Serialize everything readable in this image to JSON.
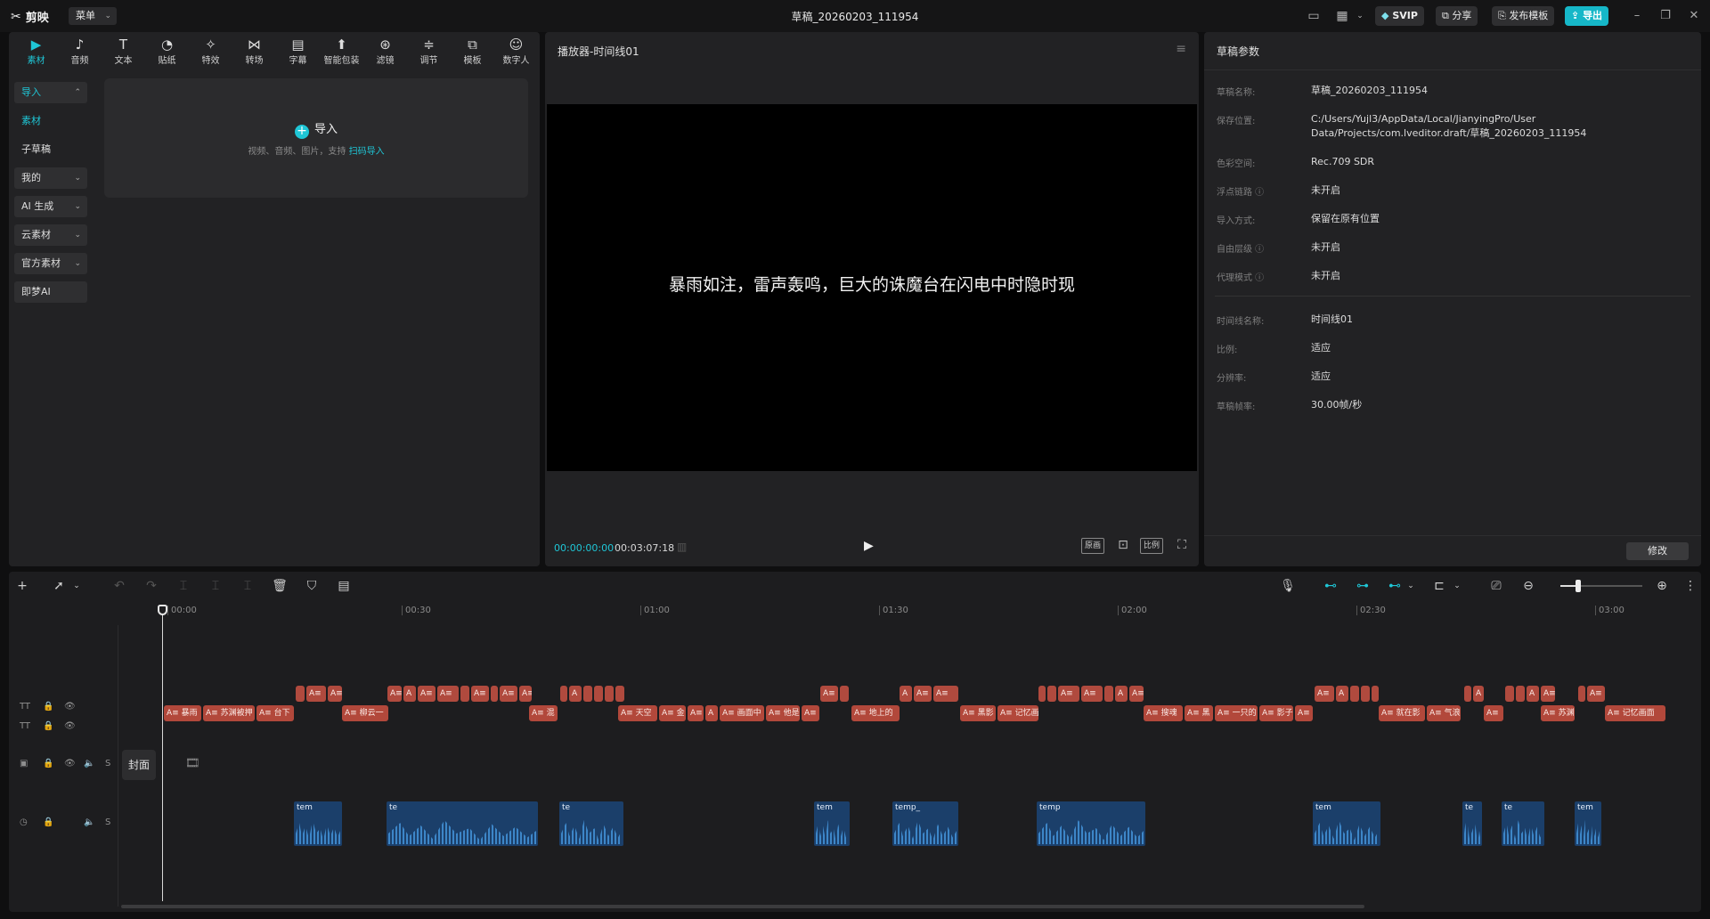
{
  "titlebar": {
    "app_name": "剪映",
    "menu_label": "菜单",
    "doc_title": "草稿_20260203_111954",
    "svip": "SVIP",
    "share": "分享",
    "publish_template": "发布模板",
    "export": "导出"
  },
  "categories": [
    {
      "label": "素材",
      "icon": "media-icon",
      "glyph": "▶"
    },
    {
      "label": "音频",
      "icon": "audio-icon",
      "glyph": "♪"
    },
    {
      "label": "文本",
      "icon": "text-icon",
      "glyph": "T"
    },
    {
      "label": "贴纸",
      "icon": "sticker-icon",
      "glyph": "◔"
    },
    {
      "label": "特效",
      "icon": "effects-icon",
      "glyph": "✧"
    },
    {
      "label": "转场",
      "icon": "transition-icon",
      "glyph": "⋈"
    },
    {
      "label": "字幕",
      "icon": "caption-icon",
      "glyph": "▤"
    },
    {
      "label": "智能包装",
      "icon": "smart-pack-icon",
      "glyph": "⬆"
    },
    {
      "label": "滤镜",
      "icon": "filter-icon",
      "glyph": "⊛"
    },
    {
      "label": "调节",
      "icon": "adjust-icon",
      "glyph": "≑"
    },
    {
      "label": "模板",
      "icon": "template-icon",
      "glyph": "⧉"
    },
    {
      "label": "数字人",
      "icon": "avatar-icon",
      "glyph": "☺"
    }
  ],
  "sidebar": {
    "items": [
      {
        "label": "导入",
        "chev": "⌃"
      },
      {
        "label": "素材",
        "chev": ""
      },
      {
        "label": "子草稿",
        "chev": ""
      },
      {
        "label": "我的",
        "chev": "⌄"
      },
      {
        "label": "AI 生成",
        "chev": "⌄"
      },
      {
        "label": "云素材",
        "chev": "⌄"
      },
      {
        "label": "官方素材",
        "chev": "⌄"
      },
      {
        "label": "即梦AI",
        "chev": ""
      }
    ]
  },
  "import_card": {
    "title": "导入",
    "subtitle": "视频、音频、图片，支持",
    "link": "扫码导入"
  },
  "player": {
    "title": "播放器-时间线01",
    "subtitle_text": "暴雨如注，雷声轰鸣，巨大的诛魔台在闪电中时隐时现",
    "current_time": "00:00:00:00",
    "total_time": "00:03:07:18",
    "ctl_quality": "原画",
    "ctl_ratio": "比例"
  },
  "params": {
    "title": "草稿参数",
    "rows": [
      {
        "label": "草稿名称:",
        "value": "草稿_20260203_111954"
      },
      {
        "label": "保存位置:",
        "value": "C:/Users/Yujl3/AppData/Local/JianyingPro/User Data/Projects/com.lveditor.draft/草稿_20260203_111954"
      },
      {
        "label": "色彩空间:",
        "value": "Rec.709 SDR"
      },
      {
        "label": "浮点链路 ⓘ",
        "value": "未开启"
      },
      {
        "label": "导入方式:",
        "value": "保留在原有位置"
      },
      {
        "label": "自由层级 ⓘ",
        "value": "未开启"
      },
      {
        "label": "代理模式 ⓘ",
        "value": "未开启"
      }
    ],
    "rows2": [
      {
        "label": "时间线名称:",
        "value": "时间线01"
      },
      {
        "label": "比例:",
        "value": "适应"
      },
      {
        "label": "分辨率:",
        "value": "适应"
      },
      {
        "label": "草稿帧率:",
        "value": "30.00帧/秒"
      }
    ],
    "modify": "修改"
  },
  "timeline": {
    "ruler": [
      "00:00",
      "00:30",
      "01:00",
      "01:30",
      "02:00",
      "02:30",
      "03:00"
    ],
    "cover_label": "封面",
    "track_headers": {
      "solo": "S"
    },
    "text_track_2_labels": [
      "暴雨",
      "苏渊被押",
      "台下",
      "柳云一",
      "混",
      "天空",
      "金",
      "画面中",
      "他是",
      "地上的",
      "黑影",
      "记忆画",
      "搜魂",
      "黑",
      "一只的",
      "影子",
      "就在影",
      "气浪",
      "苏渊",
      "记忆画面"
    ],
    "audio_labels": [
      "tem",
      "tem",
      "te",
      "te",
      "ten",
      "temp",
      "tem",
      "tem",
      "te",
      "te",
      "tem",
      "te",
      "ten",
      "temp_",
      "temp",
      "temp",
      "te",
      "te",
      "tem",
      "te",
      "te",
      "te",
      "te",
      "tem"
    ]
  }
}
